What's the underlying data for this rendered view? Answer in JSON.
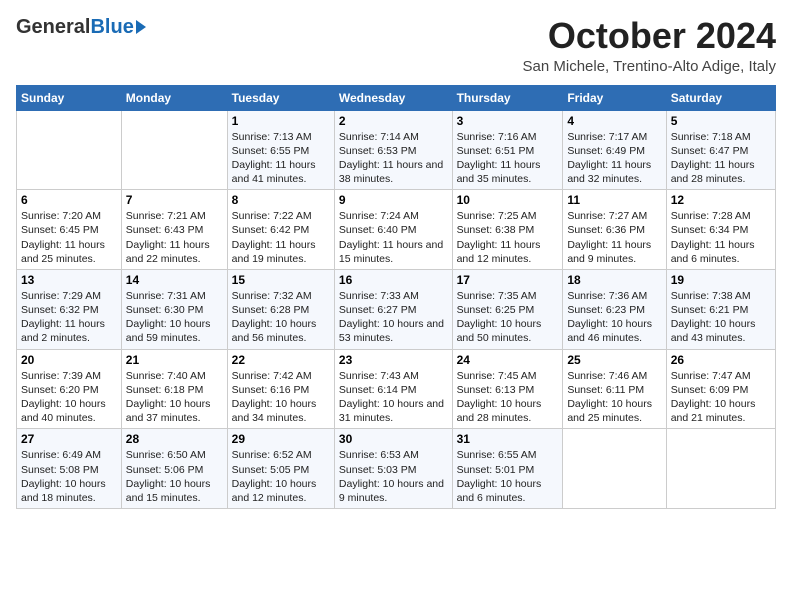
{
  "header": {
    "logo_general": "General",
    "logo_blue": "Blue",
    "month_title": "October 2024",
    "location": "San Michele, Trentino-Alto Adige, Italy"
  },
  "days_of_week": [
    "Sunday",
    "Monday",
    "Tuesday",
    "Wednesday",
    "Thursday",
    "Friday",
    "Saturday"
  ],
  "weeks": [
    [
      {
        "num": "",
        "info": ""
      },
      {
        "num": "",
        "info": ""
      },
      {
        "num": "1",
        "info": "Sunrise: 7:13 AM\nSunset: 6:55 PM\nDaylight: 11 hours and 41 minutes."
      },
      {
        "num": "2",
        "info": "Sunrise: 7:14 AM\nSunset: 6:53 PM\nDaylight: 11 hours and 38 minutes."
      },
      {
        "num": "3",
        "info": "Sunrise: 7:16 AM\nSunset: 6:51 PM\nDaylight: 11 hours and 35 minutes."
      },
      {
        "num": "4",
        "info": "Sunrise: 7:17 AM\nSunset: 6:49 PM\nDaylight: 11 hours and 32 minutes."
      },
      {
        "num": "5",
        "info": "Sunrise: 7:18 AM\nSunset: 6:47 PM\nDaylight: 11 hours and 28 minutes."
      }
    ],
    [
      {
        "num": "6",
        "info": "Sunrise: 7:20 AM\nSunset: 6:45 PM\nDaylight: 11 hours and 25 minutes."
      },
      {
        "num": "7",
        "info": "Sunrise: 7:21 AM\nSunset: 6:43 PM\nDaylight: 11 hours and 22 minutes."
      },
      {
        "num": "8",
        "info": "Sunrise: 7:22 AM\nSunset: 6:42 PM\nDaylight: 11 hours and 19 minutes."
      },
      {
        "num": "9",
        "info": "Sunrise: 7:24 AM\nSunset: 6:40 PM\nDaylight: 11 hours and 15 minutes."
      },
      {
        "num": "10",
        "info": "Sunrise: 7:25 AM\nSunset: 6:38 PM\nDaylight: 11 hours and 12 minutes."
      },
      {
        "num": "11",
        "info": "Sunrise: 7:27 AM\nSunset: 6:36 PM\nDaylight: 11 hours and 9 minutes."
      },
      {
        "num": "12",
        "info": "Sunrise: 7:28 AM\nSunset: 6:34 PM\nDaylight: 11 hours and 6 minutes."
      }
    ],
    [
      {
        "num": "13",
        "info": "Sunrise: 7:29 AM\nSunset: 6:32 PM\nDaylight: 11 hours and 2 minutes."
      },
      {
        "num": "14",
        "info": "Sunrise: 7:31 AM\nSunset: 6:30 PM\nDaylight: 10 hours and 59 minutes."
      },
      {
        "num": "15",
        "info": "Sunrise: 7:32 AM\nSunset: 6:28 PM\nDaylight: 10 hours and 56 minutes."
      },
      {
        "num": "16",
        "info": "Sunrise: 7:33 AM\nSunset: 6:27 PM\nDaylight: 10 hours and 53 minutes."
      },
      {
        "num": "17",
        "info": "Sunrise: 7:35 AM\nSunset: 6:25 PM\nDaylight: 10 hours and 50 minutes."
      },
      {
        "num": "18",
        "info": "Sunrise: 7:36 AM\nSunset: 6:23 PM\nDaylight: 10 hours and 46 minutes."
      },
      {
        "num": "19",
        "info": "Sunrise: 7:38 AM\nSunset: 6:21 PM\nDaylight: 10 hours and 43 minutes."
      }
    ],
    [
      {
        "num": "20",
        "info": "Sunrise: 7:39 AM\nSunset: 6:20 PM\nDaylight: 10 hours and 40 minutes."
      },
      {
        "num": "21",
        "info": "Sunrise: 7:40 AM\nSunset: 6:18 PM\nDaylight: 10 hours and 37 minutes."
      },
      {
        "num": "22",
        "info": "Sunrise: 7:42 AM\nSunset: 6:16 PM\nDaylight: 10 hours and 34 minutes."
      },
      {
        "num": "23",
        "info": "Sunrise: 7:43 AM\nSunset: 6:14 PM\nDaylight: 10 hours and 31 minutes."
      },
      {
        "num": "24",
        "info": "Sunrise: 7:45 AM\nSunset: 6:13 PM\nDaylight: 10 hours and 28 minutes."
      },
      {
        "num": "25",
        "info": "Sunrise: 7:46 AM\nSunset: 6:11 PM\nDaylight: 10 hours and 25 minutes."
      },
      {
        "num": "26",
        "info": "Sunrise: 7:47 AM\nSunset: 6:09 PM\nDaylight: 10 hours and 21 minutes."
      }
    ],
    [
      {
        "num": "27",
        "info": "Sunrise: 6:49 AM\nSunset: 5:08 PM\nDaylight: 10 hours and 18 minutes."
      },
      {
        "num": "28",
        "info": "Sunrise: 6:50 AM\nSunset: 5:06 PM\nDaylight: 10 hours and 15 minutes."
      },
      {
        "num": "29",
        "info": "Sunrise: 6:52 AM\nSunset: 5:05 PM\nDaylight: 10 hours and 12 minutes."
      },
      {
        "num": "30",
        "info": "Sunrise: 6:53 AM\nSunset: 5:03 PM\nDaylight: 10 hours and 9 minutes."
      },
      {
        "num": "31",
        "info": "Sunrise: 6:55 AM\nSunset: 5:01 PM\nDaylight: 10 hours and 6 minutes."
      },
      {
        "num": "",
        "info": ""
      },
      {
        "num": "",
        "info": ""
      }
    ]
  ]
}
